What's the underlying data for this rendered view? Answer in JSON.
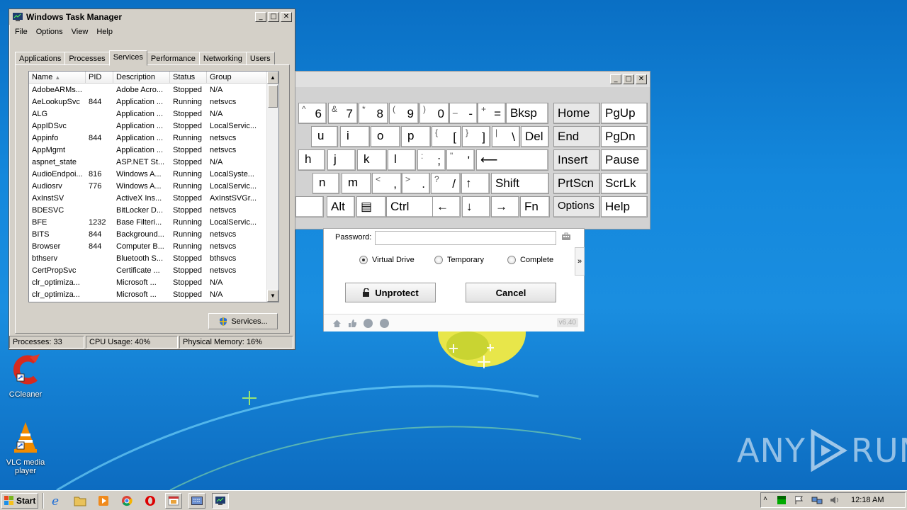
{
  "task_manager": {
    "title": "Windows Task Manager",
    "menus": [
      "File",
      "Options",
      "View",
      "Help"
    ],
    "tabs": [
      "Applications",
      "Processes",
      "Services",
      "Performance",
      "Networking",
      "Users"
    ],
    "active_tab": "Services",
    "columns": [
      "Name",
      "PID",
      "Description",
      "Status",
      "Group"
    ],
    "rows": [
      [
        "AdobeARMs...",
        "",
        "Adobe Acro...",
        "Stopped",
        "N/A"
      ],
      [
        "AeLookupSvc",
        "844",
        "Application ...",
        "Running",
        "netsvcs"
      ],
      [
        "ALG",
        "",
        "Application ...",
        "Stopped",
        "N/A"
      ],
      [
        "AppIDSvc",
        "",
        "Application ...",
        "Stopped",
        "LocalServic..."
      ],
      [
        "Appinfo",
        "844",
        "Application ...",
        "Running",
        "netsvcs"
      ],
      [
        "AppMgmt",
        "",
        "Application ...",
        "Stopped",
        "netsvcs"
      ],
      [
        "aspnet_state",
        "",
        "ASP.NET St...",
        "Stopped",
        "N/A"
      ],
      [
        "AudioEndpoi...",
        "816",
        "Windows A...",
        "Running",
        "LocalSyste..."
      ],
      [
        "Audiosrv",
        "776",
        "Windows A...",
        "Running",
        "LocalServic..."
      ],
      [
        "AxInstSV",
        "",
        "ActiveX Ins...",
        "Stopped",
        "AxInstSVGr..."
      ],
      [
        "BDESVC",
        "",
        "BitLocker D...",
        "Stopped",
        "netsvcs"
      ],
      [
        "BFE",
        "1232",
        "Base Filteri...",
        "Running",
        "LocalServic..."
      ],
      [
        "BITS",
        "844",
        "Background...",
        "Running",
        "netsvcs"
      ],
      [
        "Browser",
        "844",
        "Computer B...",
        "Running",
        "netsvcs"
      ],
      [
        "bthserv",
        "",
        "Bluetooth S...",
        "Stopped",
        "bthsvcs"
      ],
      [
        "CertPropSvc",
        "",
        "Certificate ...",
        "Stopped",
        "netsvcs"
      ],
      [
        "clr_optimiza...",
        "",
        "Microsoft ...",
        "Stopped",
        "N/A"
      ],
      [
        "clr_optimiza...",
        "",
        "Microsoft ...",
        "Stopped",
        "N/A"
      ]
    ],
    "services_button": "Services...",
    "status": {
      "processes": "Processes: 33",
      "cpu": "CPU Usage: 40%",
      "memory": "Physical Memory: 16%"
    }
  },
  "keyboard": {
    "keys": [
      {
        "main": "6",
        "shift": "^"
      },
      {
        "main": "7",
        "shift": "&"
      },
      {
        "main": "8",
        "shift": "*"
      },
      {
        "main": "9",
        "shift": "("
      },
      {
        "main": "0",
        "shift": ")"
      },
      {
        "main": "-",
        "shift": "_"
      },
      {
        "main": "=",
        "shift": "+"
      },
      {
        "word": "Bksp"
      },
      {
        "word": "Home"
      },
      {
        "word": "PgUp"
      },
      {
        "main": "u"
      },
      {
        "main": "i"
      },
      {
        "main": "o"
      },
      {
        "main": "p"
      },
      {
        "main": "[",
        "shift": "{"
      },
      {
        "main": "]",
        "shift": "}"
      },
      {
        "main": "\\",
        "shift": "|"
      },
      {
        "word": "Del"
      },
      {
        "word": "End"
      },
      {
        "word": "PgDn"
      },
      {
        "main": "h"
      },
      {
        "main": "j"
      },
      {
        "main": "k"
      },
      {
        "main": "l"
      },
      {
        "main": ";",
        "shift": ":"
      },
      {
        "main": "'",
        "shift": "\""
      },
      {
        "word": "⟵"
      },
      {
        "word": "Insert"
      },
      {
        "word": "Pause"
      },
      {
        "main": "n"
      },
      {
        "main": "m"
      },
      {
        "main": ",",
        "shift": "<"
      },
      {
        "main": ".",
        "shift": ">"
      },
      {
        "main": "/",
        "shift": "?"
      },
      {
        "word": "↑"
      },
      {
        "word": "Shift"
      },
      {
        "word": "PrtScn"
      },
      {
        "word": "ScrLk"
      },
      {
        "word": ""
      },
      {
        "word": "Alt"
      },
      {
        "word": "▤"
      },
      {
        "word": "Ctrl"
      },
      {
        "word": "←"
      },
      {
        "word": "↓"
      },
      {
        "word": "→"
      },
      {
        "word": "Fn"
      },
      {
        "word": "Options"
      },
      {
        "word": "Help"
      }
    ]
  },
  "dialog": {
    "password_label": "Password:",
    "radios": [
      "Virtual Drive",
      "Temporary",
      "Complete"
    ],
    "selected_radio": "Virtual Drive",
    "expander": "»",
    "unprotect_label": "Unprotect",
    "cancel_label": "Cancel",
    "version": "v6.40"
  },
  "desktop": {
    "icons": [
      "CCleaner",
      "VLC media player"
    ],
    "watermark_left": "ANY",
    "watermark_right": "RUN"
  },
  "taskbar": {
    "start_label": "Start",
    "clock": "12:18 AM"
  },
  "colors": {
    "desktop_blue": "#1488dc",
    "window_face": "#d4d0c8"
  }
}
